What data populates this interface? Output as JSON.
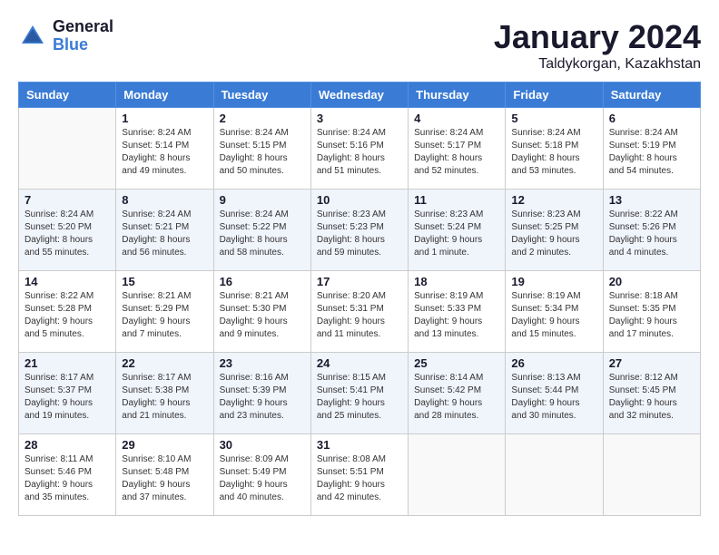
{
  "logo": {
    "general": "General",
    "blue": "Blue"
  },
  "title": "January 2024",
  "location": "Taldykorgan, Kazakhstan",
  "days_of_week": [
    "Sunday",
    "Monday",
    "Tuesday",
    "Wednesday",
    "Thursday",
    "Friday",
    "Saturday"
  ],
  "weeks": [
    [
      {
        "day": "",
        "sunrise": "",
        "sunset": "",
        "daylight": ""
      },
      {
        "day": "1",
        "sunrise": "Sunrise: 8:24 AM",
        "sunset": "Sunset: 5:14 PM",
        "daylight": "Daylight: 8 hours and 49 minutes."
      },
      {
        "day": "2",
        "sunrise": "Sunrise: 8:24 AM",
        "sunset": "Sunset: 5:15 PM",
        "daylight": "Daylight: 8 hours and 50 minutes."
      },
      {
        "day": "3",
        "sunrise": "Sunrise: 8:24 AM",
        "sunset": "Sunset: 5:16 PM",
        "daylight": "Daylight: 8 hours and 51 minutes."
      },
      {
        "day": "4",
        "sunrise": "Sunrise: 8:24 AM",
        "sunset": "Sunset: 5:17 PM",
        "daylight": "Daylight: 8 hours and 52 minutes."
      },
      {
        "day": "5",
        "sunrise": "Sunrise: 8:24 AM",
        "sunset": "Sunset: 5:18 PM",
        "daylight": "Daylight: 8 hours and 53 minutes."
      },
      {
        "day": "6",
        "sunrise": "Sunrise: 8:24 AM",
        "sunset": "Sunset: 5:19 PM",
        "daylight": "Daylight: 8 hours and 54 minutes."
      }
    ],
    [
      {
        "day": "7",
        "sunrise": "Sunrise: 8:24 AM",
        "sunset": "Sunset: 5:20 PM",
        "daylight": "Daylight: 8 hours and 55 minutes."
      },
      {
        "day": "8",
        "sunrise": "Sunrise: 8:24 AM",
        "sunset": "Sunset: 5:21 PM",
        "daylight": "Daylight: 8 hours and 56 minutes."
      },
      {
        "day": "9",
        "sunrise": "Sunrise: 8:24 AM",
        "sunset": "Sunset: 5:22 PM",
        "daylight": "Daylight: 8 hours and 58 minutes."
      },
      {
        "day": "10",
        "sunrise": "Sunrise: 8:23 AM",
        "sunset": "Sunset: 5:23 PM",
        "daylight": "Daylight: 8 hours and 59 minutes."
      },
      {
        "day": "11",
        "sunrise": "Sunrise: 8:23 AM",
        "sunset": "Sunset: 5:24 PM",
        "daylight": "Daylight: 9 hours and 1 minute."
      },
      {
        "day": "12",
        "sunrise": "Sunrise: 8:23 AM",
        "sunset": "Sunset: 5:25 PM",
        "daylight": "Daylight: 9 hours and 2 minutes."
      },
      {
        "day": "13",
        "sunrise": "Sunrise: 8:22 AM",
        "sunset": "Sunset: 5:26 PM",
        "daylight": "Daylight: 9 hours and 4 minutes."
      }
    ],
    [
      {
        "day": "14",
        "sunrise": "Sunrise: 8:22 AM",
        "sunset": "Sunset: 5:28 PM",
        "daylight": "Daylight: 9 hours and 5 minutes."
      },
      {
        "day": "15",
        "sunrise": "Sunrise: 8:21 AM",
        "sunset": "Sunset: 5:29 PM",
        "daylight": "Daylight: 9 hours and 7 minutes."
      },
      {
        "day": "16",
        "sunrise": "Sunrise: 8:21 AM",
        "sunset": "Sunset: 5:30 PM",
        "daylight": "Daylight: 9 hours and 9 minutes."
      },
      {
        "day": "17",
        "sunrise": "Sunrise: 8:20 AM",
        "sunset": "Sunset: 5:31 PM",
        "daylight": "Daylight: 9 hours and 11 minutes."
      },
      {
        "day": "18",
        "sunrise": "Sunrise: 8:19 AM",
        "sunset": "Sunset: 5:33 PM",
        "daylight": "Daylight: 9 hours and 13 minutes."
      },
      {
        "day": "19",
        "sunrise": "Sunrise: 8:19 AM",
        "sunset": "Sunset: 5:34 PM",
        "daylight": "Daylight: 9 hours and 15 minutes."
      },
      {
        "day": "20",
        "sunrise": "Sunrise: 8:18 AM",
        "sunset": "Sunset: 5:35 PM",
        "daylight": "Daylight: 9 hours and 17 minutes."
      }
    ],
    [
      {
        "day": "21",
        "sunrise": "Sunrise: 8:17 AM",
        "sunset": "Sunset: 5:37 PM",
        "daylight": "Daylight: 9 hours and 19 minutes."
      },
      {
        "day": "22",
        "sunrise": "Sunrise: 8:17 AM",
        "sunset": "Sunset: 5:38 PM",
        "daylight": "Daylight: 9 hours and 21 minutes."
      },
      {
        "day": "23",
        "sunrise": "Sunrise: 8:16 AM",
        "sunset": "Sunset: 5:39 PM",
        "daylight": "Daylight: 9 hours and 23 minutes."
      },
      {
        "day": "24",
        "sunrise": "Sunrise: 8:15 AM",
        "sunset": "Sunset: 5:41 PM",
        "daylight": "Daylight: 9 hours and 25 minutes."
      },
      {
        "day": "25",
        "sunrise": "Sunrise: 8:14 AM",
        "sunset": "Sunset: 5:42 PM",
        "daylight": "Daylight: 9 hours and 28 minutes."
      },
      {
        "day": "26",
        "sunrise": "Sunrise: 8:13 AM",
        "sunset": "Sunset: 5:44 PM",
        "daylight": "Daylight: 9 hours and 30 minutes."
      },
      {
        "day": "27",
        "sunrise": "Sunrise: 8:12 AM",
        "sunset": "Sunset: 5:45 PM",
        "daylight": "Daylight: 9 hours and 32 minutes."
      }
    ],
    [
      {
        "day": "28",
        "sunrise": "Sunrise: 8:11 AM",
        "sunset": "Sunset: 5:46 PM",
        "daylight": "Daylight: 9 hours and 35 minutes."
      },
      {
        "day": "29",
        "sunrise": "Sunrise: 8:10 AM",
        "sunset": "Sunset: 5:48 PM",
        "daylight": "Daylight: 9 hours and 37 minutes."
      },
      {
        "day": "30",
        "sunrise": "Sunrise: 8:09 AM",
        "sunset": "Sunset: 5:49 PM",
        "daylight": "Daylight: 9 hours and 40 minutes."
      },
      {
        "day": "31",
        "sunrise": "Sunrise: 8:08 AM",
        "sunset": "Sunset: 5:51 PM",
        "daylight": "Daylight: 9 hours and 42 minutes."
      },
      {
        "day": "",
        "sunrise": "",
        "sunset": "",
        "daylight": ""
      },
      {
        "day": "",
        "sunrise": "",
        "sunset": "",
        "daylight": ""
      },
      {
        "day": "",
        "sunrise": "",
        "sunset": "",
        "daylight": ""
      }
    ]
  ]
}
